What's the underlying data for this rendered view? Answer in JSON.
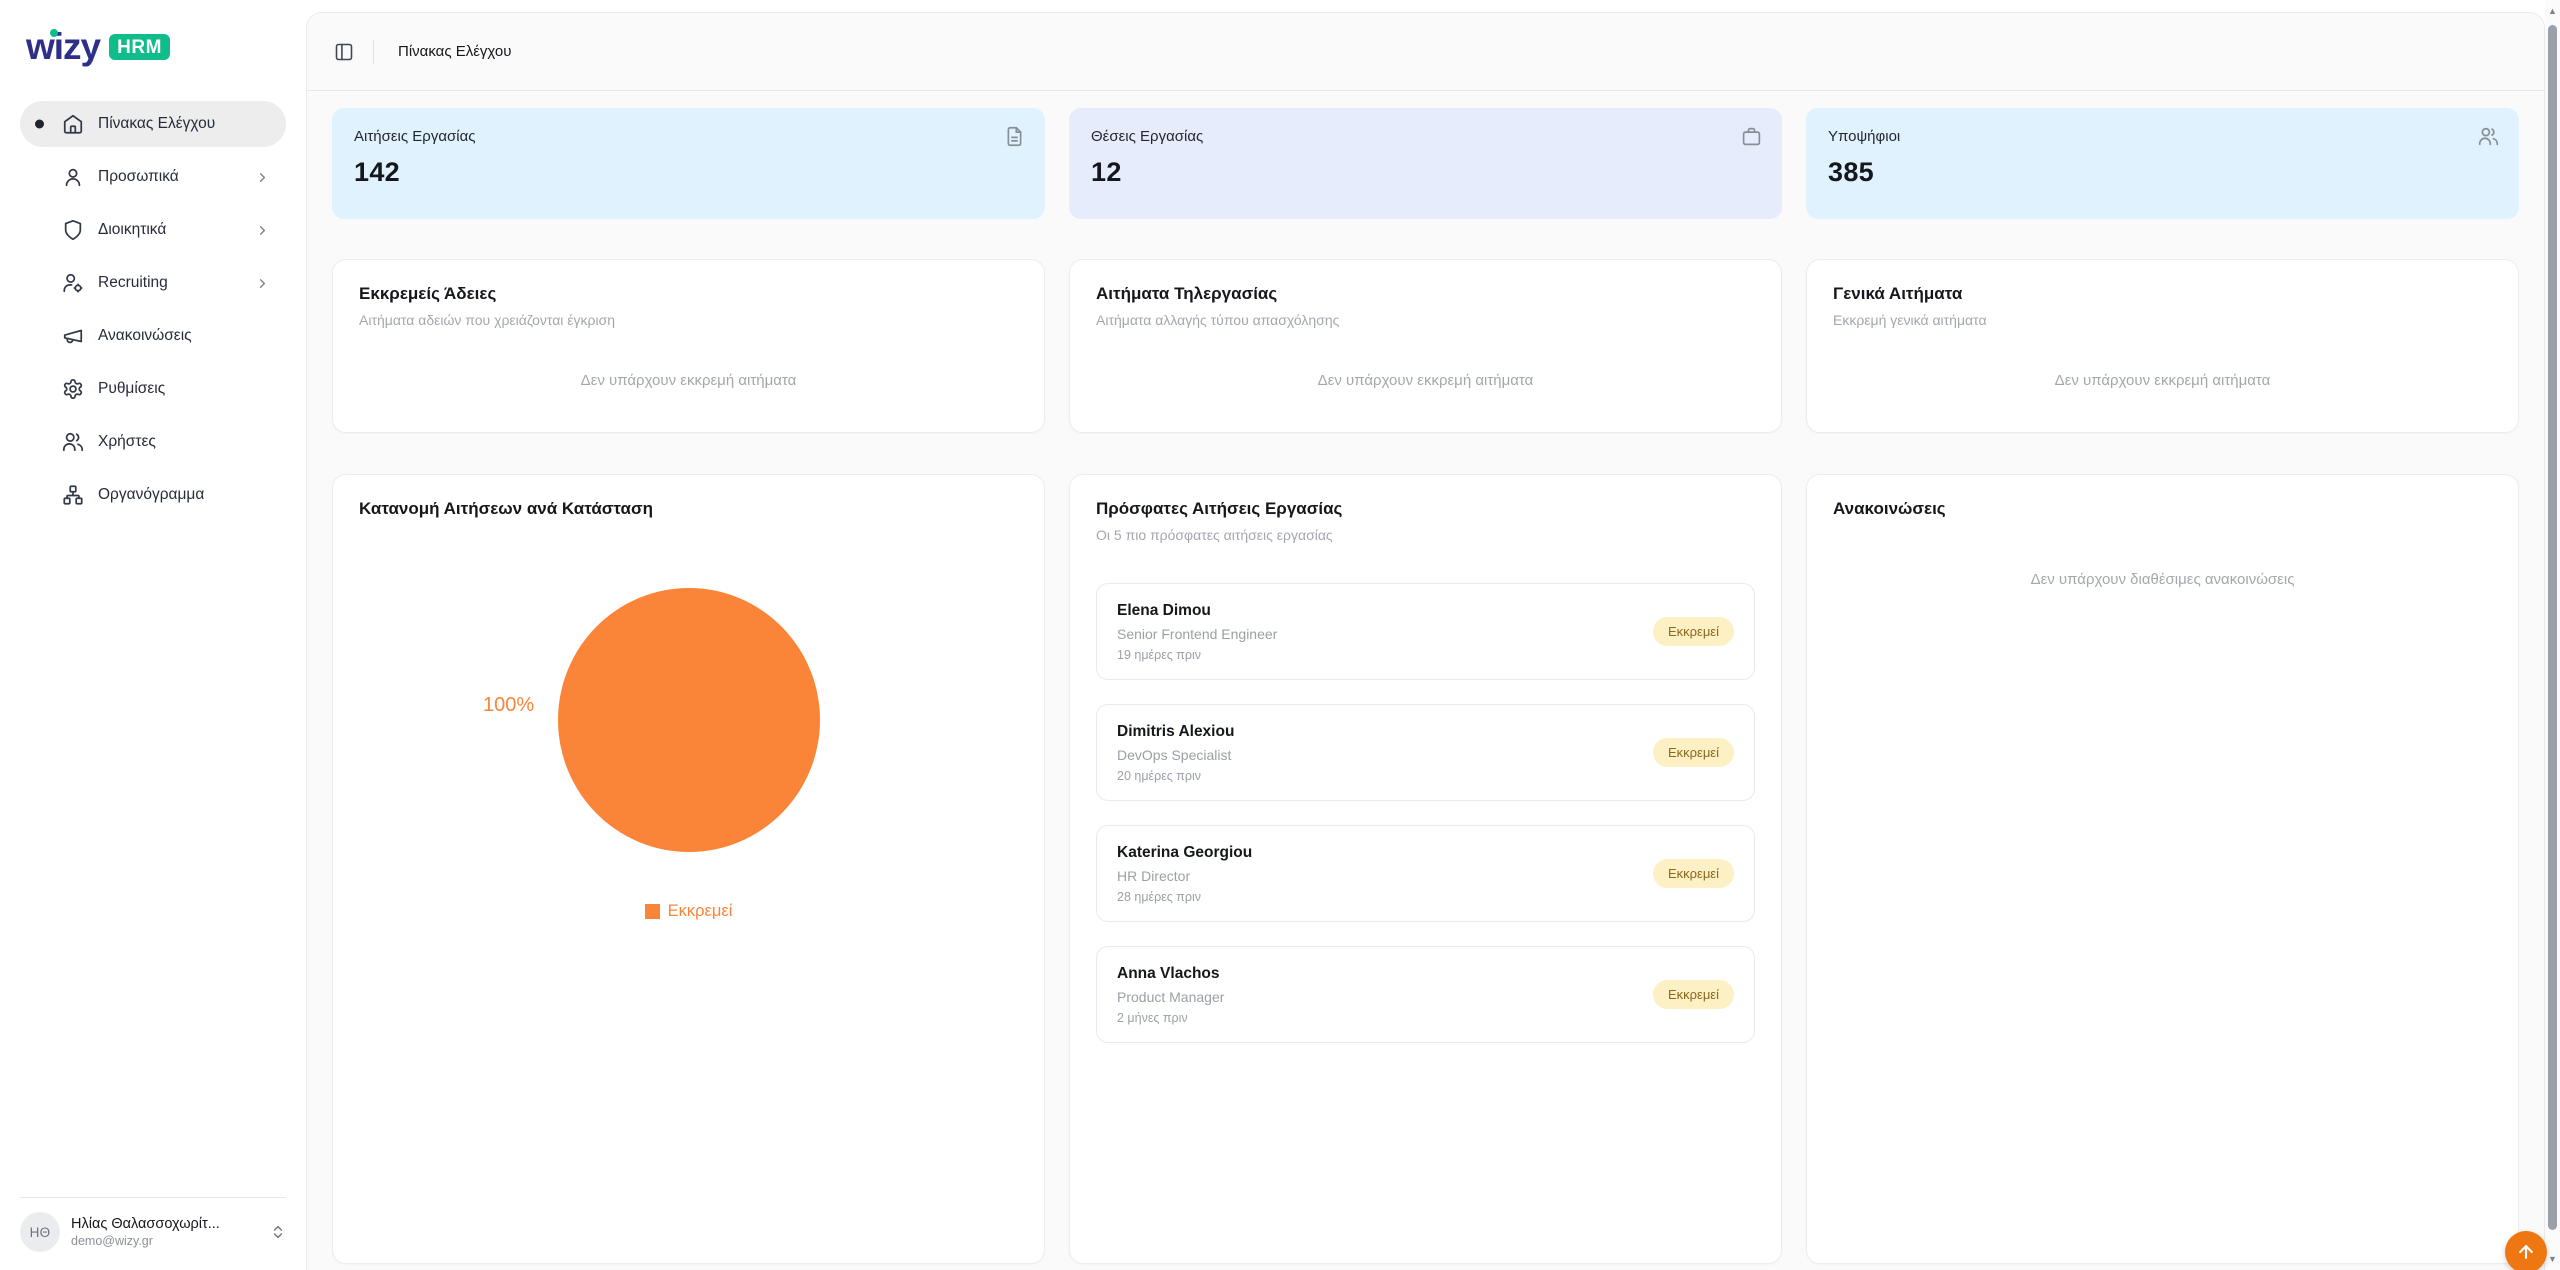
{
  "brand": {
    "name": "wizy",
    "badge": "HRM"
  },
  "sidebar": {
    "items": [
      {
        "label": "Πίνακας Ελέγχου",
        "icon": "home-icon",
        "active": true
      },
      {
        "label": "Προσωπικά",
        "icon": "user-icon",
        "expandable": true
      },
      {
        "label": "Διοικητικά",
        "icon": "shield-icon",
        "expandable": true
      },
      {
        "label": "Recruiting",
        "icon": "user-cog-icon",
        "expandable": true
      },
      {
        "label": "Ανακοινώσεις",
        "icon": "megaphone-icon"
      },
      {
        "label": "Ρυθμίσεις",
        "icon": "settings-icon"
      },
      {
        "label": "Χρήστες",
        "icon": "users-icon"
      },
      {
        "label": "Οργανόγραμμα",
        "icon": "org-chart-icon"
      }
    ],
    "user": {
      "initials": "ΗΘ",
      "name": "Ηλίας Θαλασσοχωρίτ...",
      "email": "demo@wizy.gr"
    }
  },
  "header": {
    "title": "Πίνακας Ελέγχου"
  },
  "stats": [
    {
      "label": "Αιτήσεις Εργασίας",
      "value": "142",
      "icon": "file-text-icon",
      "bg": "#e0f2fe"
    },
    {
      "label": "Θέσεις Εργασίας",
      "value": "12",
      "icon": "briefcase-icon",
      "bg": "#e7ecfd"
    },
    {
      "label": "Υποψήφιοι",
      "value": "385",
      "icon": "users-icon",
      "bg": "#e0f2fe"
    }
  ],
  "request_cards": [
    {
      "title": "Εκκρεμείς Άδειες",
      "subtitle": "Αιτήματα αδειών που χρειάζονται έγκριση",
      "empty": "Δεν υπάρχουν εκκρεμή αιτήματα"
    },
    {
      "title": "Αιτήματα Τηλεργασίας",
      "subtitle": "Αιτήματα αλλαγής τύπου απασχόλησης",
      "empty": "Δεν υπάρχουν εκκρεμή αιτήματα"
    },
    {
      "title": "Γενικά Αιτήματα",
      "subtitle": "Εκκρεμή γενικά αιτήματα",
      "empty": "Δεν υπάρχουν εκκρεμή αιτήματα"
    }
  ],
  "chart_card": {
    "title": "Κατανομή Αιτήσεων ανά Κατάσταση"
  },
  "chart_data": {
    "type": "pie",
    "title": "Κατανομή Αιτήσεων ανά Κατάσταση",
    "slices": [
      {
        "label": "Εκκρεμεί",
        "value": 100,
        "percent_label": "100%",
        "color": "#fa8539"
      }
    ],
    "legend_position": "bottom"
  },
  "recent": {
    "title": "Πρόσφατες Αιτήσεις Εργασίας",
    "subtitle": "Οι 5 πιο πρόσφατες αιτήσεις εργασίας",
    "items": [
      {
        "name": "Elena Dimou",
        "role": "Senior Frontend Engineer",
        "time": "19 ημέρες πριν",
        "status": "Εκκρεμεί"
      },
      {
        "name": "Dimitris Alexiou",
        "role": "DevOps Specialist",
        "time": "20 ημέρες πριν",
        "status": "Εκκρεμεί"
      },
      {
        "name": "Katerina Georgiou",
        "role": "HR Director",
        "time": "28 ημέρες πριν",
        "status": "Εκκρεμεί"
      },
      {
        "name": "Anna Vlachos",
        "role": "Product Manager",
        "time": "2 μήνες πριν",
        "status": "Εκκρεμεί"
      }
    ]
  },
  "announcements": {
    "title": "Ανακοινώσεις",
    "empty": "Δεν υπάρχουν διαθέσιμες ανακοινώσεις"
  },
  "colors": {
    "brand_blue": "#2e2f87",
    "brand_green": "#10bd8a",
    "stat_sky_bg": "#e0f2fe",
    "stat_indigo_bg": "#e7ecfd",
    "pie_orange": "#fa8539",
    "fab_orange": "#ee7712",
    "badge_bg": "#fcf0c4",
    "badge_text": "#8a681c",
    "panel_bg": "#fafafa",
    "active_pill": "#ededed"
  }
}
